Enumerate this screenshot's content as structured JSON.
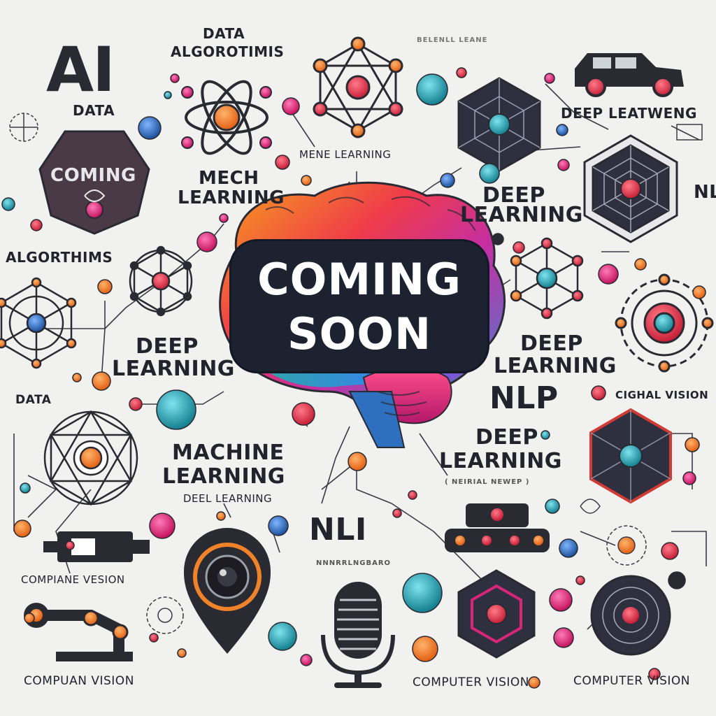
{
  "banner": {
    "line1": "COMING",
    "line2": "SOON"
  },
  "labels": {
    "ai": "AI",
    "data_top": "DATA",
    "algorithms_top": "ALGOROTIMIS",
    "data_left": "DATA",
    "mech_line1": "MECH",
    "mech_line2": "LEARNING",
    "mene": "MENE LEARNING",
    "deep_leatweng": "DEEP LEATWENG",
    "deep_top_line1": "DEEP",
    "deep_top_line2": "LEARNING",
    "nl_edge": "NL",
    "coming_badge": "COMING",
    "algorthims": "ALGORTHIMS",
    "deep_left_line1": "DEEP",
    "deep_left_line2": "LEARNING",
    "deep_right_line1": "DEEP",
    "deep_right_line2": "LEARNING",
    "data_mid": "DATA",
    "nlp": "NLP",
    "cighal_vision": "CIGHAL VISION",
    "deep_nlp_line1": "DEEP",
    "deep_nlp_line2": "LEARNING",
    "neural_network": "( NEIRIAL NEWEP )",
    "machine_line1": "MACHINE",
    "machine_line2": "LEARNING",
    "deel_learning": "DEEL LEARNING",
    "nli": "NLI",
    "nli_sub": "NNNRRLNGBARO",
    "compiane_vision": "COMPIANE VESION",
    "compuan_vision": "COMPUAN VISION",
    "computer_vision_1": "COMPUTER VISION",
    "computer_vision_2": "COMPUTER VISION",
    "scribble_top": "BELENLL LEANE"
  },
  "colors": {
    "background": "#f1f1ef",
    "banner": "#1c2230",
    "orange": "#f0822a",
    "red": "#e33a4f",
    "pink": "#e0307a",
    "teal": "#2aa6b4",
    "blue": "#2b78c8",
    "dark": "#2a2a33"
  },
  "icons": [
    "atom-icon",
    "molecule-icon",
    "polyhedron-icon",
    "brain-icon",
    "network-icon",
    "car-icon",
    "camera-icon",
    "microphone-icon",
    "robot-arm-icon",
    "chip-icon",
    "hexagon-node-icon",
    "gear-node-icon"
  ]
}
